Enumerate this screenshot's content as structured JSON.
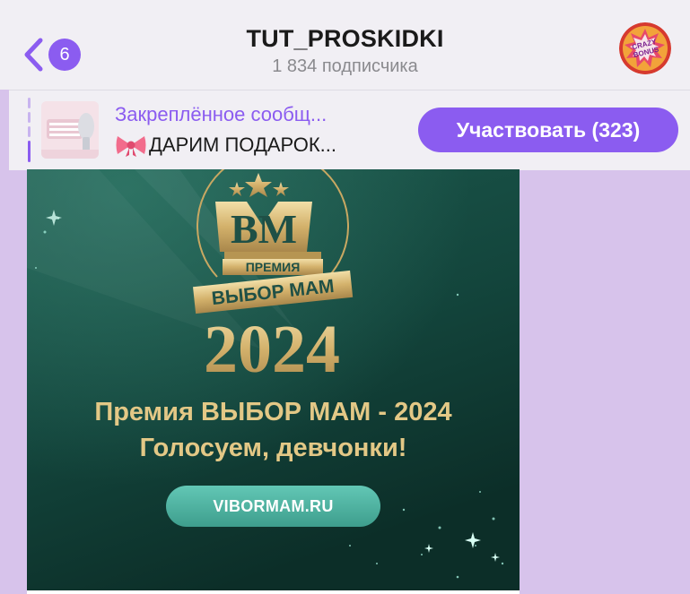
{
  "header": {
    "unread_count": "6",
    "title": "TUT_PROSKIDKI",
    "subscribers": "1 834 подписчика",
    "avatar_text_top": "CRAZY",
    "avatar_text_bottom": "BONUS",
    "back_icon": "chevron-left-icon"
  },
  "pinned": {
    "label": "Закреплённое сообщ...",
    "preview_text": "ДАРИМ ПОДАРОК...",
    "preview_icon": "bow-emoji-icon",
    "action_label": "Участвовать (323)"
  },
  "message": {
    "logo_letters": "ВМ",
    "logo_ribbon_top": "ПРЕМИЯ",
    "logo_ribbon_main": "ВЫБОР МАМ",
    "logo_year": "2024",
    "headline": "Премия ВЫБОР МАМ - 2024",
    "subheadline": "Голосуем, девчонки!",
    "button_label": "VIBORMAM.RU"
  },
  "colors": {
    "accent": "#8b5cf0",
    "chat_background": "#d7c3eb",
    "header_background": "#f1eff4",
    "gold": "#e3c886",
    "banner_green": "#123f37",
    "button_teal": "#4fb3a1"
  }
}
